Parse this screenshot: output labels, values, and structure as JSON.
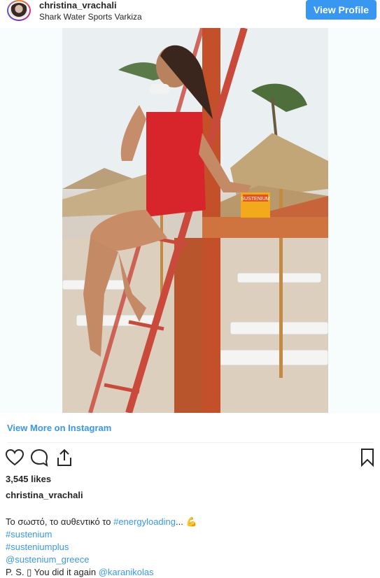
{
  "header": {
    "username": "christina_vrachali",
    "location": "Shark Water Sports Varkiza",
    "view_profile_label": "View Profile"
  },
  "post": {
    "image_alt": "Woman in red swimsuit sitting on a red lifeguard ladder at a beach",
    "product_label": "SUSTENIUM"
  },
  "links": {
    "view_more": "View More on Instagram"
  },
  "actions": {
    "like_icon": "heart-icon",
    "comment_icon": "comment-icon",
    "share_icon": "share-icon",
    "save_icon": "bookmark-icon"
  },
  "stats": {
    "likes": "3,545 likes"
  },
  "caption": {
    "author": "christina_vrachali",
    "line1_text": "Το σωστό, το αυθεντικό το ",
    "line1_tag": "#energyloading",
    "line1_suffix": "... 💪",
    "tag1": "#sustenium",
    "tag2": "#susteniumplus",
    "mention1": "@sustenium_greece",
    "line5_text": "P. S. ▯ You did it again ",
    "mention2": "@karanikolas"
  },
  "colors": {
    "accent": "#3897f0",
    "text": "#262626"
  }
}
